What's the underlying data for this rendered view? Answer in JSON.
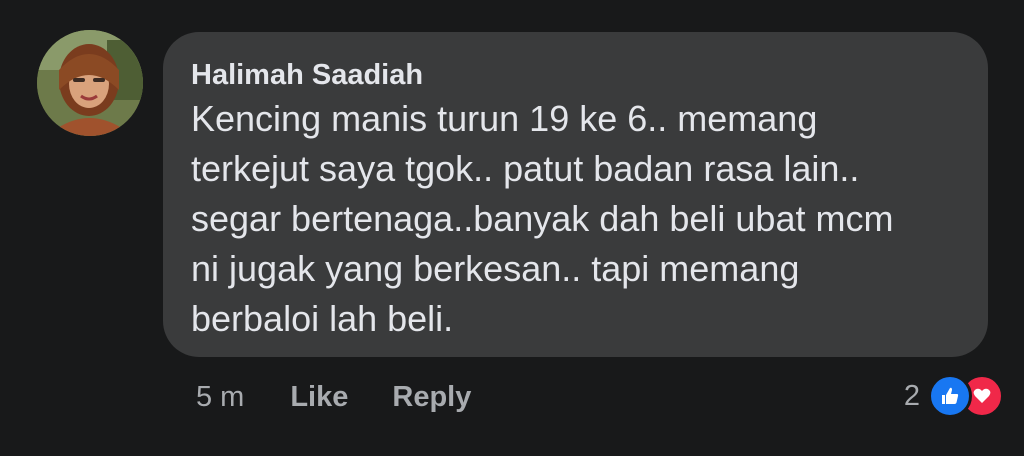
{
  "comment": {
    "author": "Halimah Saadiah",
    "text_lines": [
      "Kencing manis turun 19 ke 6.. memang",
      "terkejut saya tgok.. patut badan rasa lain..",
      "segar bertenaga..banyak dah beli ubat mcm",
      "ni jugak yang berkesan.. tapi memang",
      "berbaloi lah beli."
    ],
    "timestamp": "5 m",
    "like_label": "Like",
    "reply_label": "Reply",
    "reaction_count": "2",
    "reaction_icons": [
      "like-icon",
      "love-icon"
    ]
  },
  "colors": {
    "background": "#18191a",
    "bubble": "#3a3b3c",
    "primary_text": "#e4e6eb",
    "secondary_text": "#a8abaf",
    "like_blue": "#1877f2",
    "love_red": "#f02849"
  }
}
